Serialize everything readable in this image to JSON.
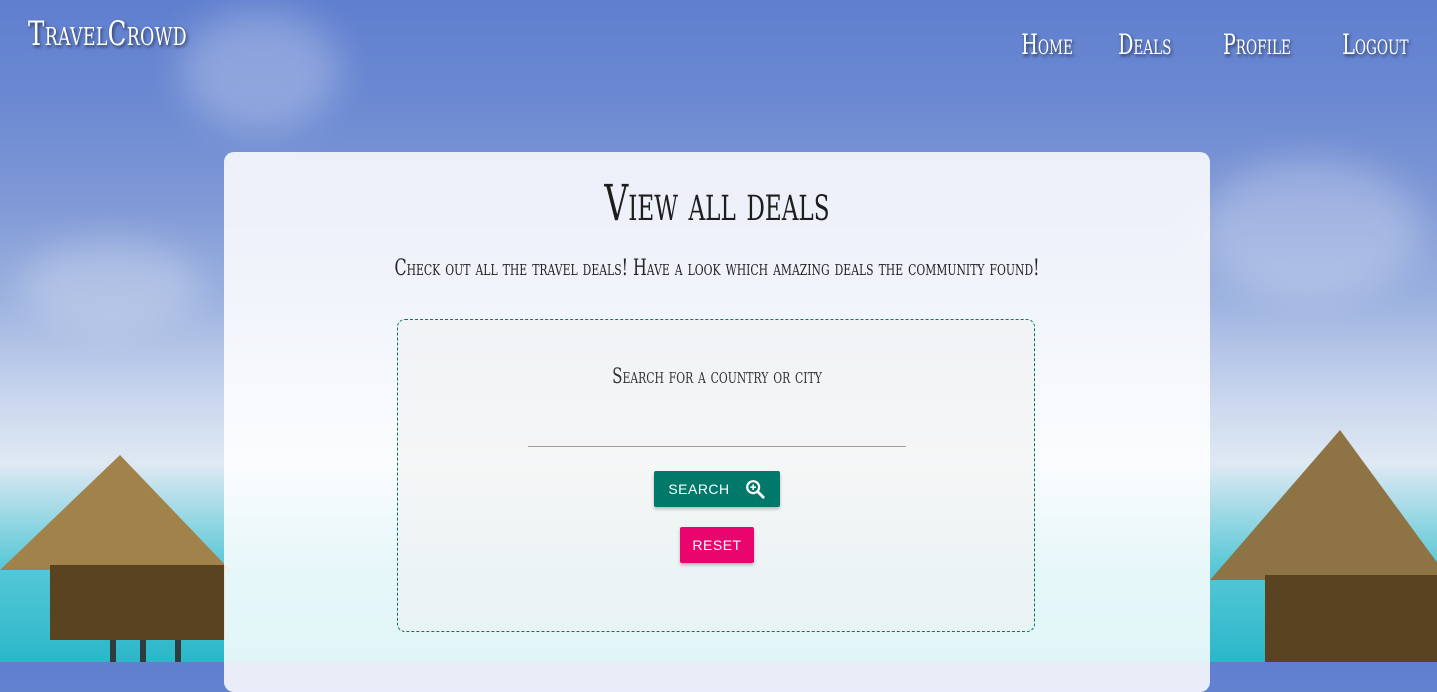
{
  "nav": {
    "brand": "TravelCrowd",
    "links": [
      {
        "label": "Home"
      },
      {
        "label": "Deals"
      },
      {
        "label": "Profile"
      },
      {
        "label": "Logout"
      }
    ]
  },
  "card": {
    "title": "View all deals",
    "subtitle": "Check out all the travel deals! Have a look which amazing deals the community found!"
  },
  "search": {
    "label": "Search for a country or city",
    "value": "",
    "search_button": "SEARCH",
    "search_icon": "zoom-search-icon",
    "reset_button": "RESET"
  },
  "colors": {
    "search_button": "#00796b",
    "reset_button": "#e9046e",
    "search_box_border": "#00796b"
  }
}
